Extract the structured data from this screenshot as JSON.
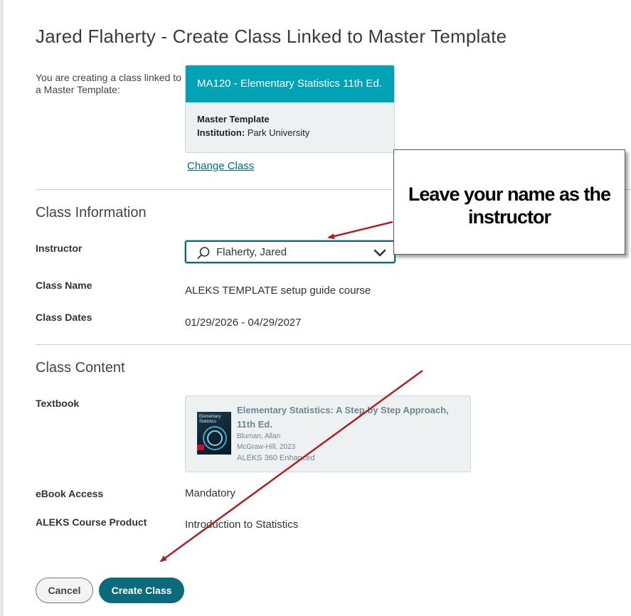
{
  "header": {
    "title": "Jared Flaherty - Create Class Linked to Master Template"
  },
  "intro": {
    "text": "You are creating a class linked to a Master Template:"
  },
  "template_card": {
    "class_name": "MA120 - Elementary Statistics 11th Ed.",
    "type_label": "Master Template",
    "institution_label": "Institution:",
    "institution_value": "Park University"
  },
  "change_class_link": "Change Class",
  "class_information": {
    "heading": "Class Information",
    "instructor_label": "Instructor",
    "instructor_value": "Flaherty, Jared",
    "class_name_label": "Class Name",
    "class_name_value": "ALEKS TEMPLATE setup guide course",
    "class_dates_label": "Class Dates",
    "class_dates_value": "01/29/2026 - 04/29/2027"
  },
  "class_content": {
    "heading": "Class Content",
    "textbook_label": "Textbook",
    "textbook": {
      "title": "Elementary Statistics: A Step by Step Approach, 11th Ed.",
      "author": "Bluman, Allan",
      "publisher": "McGraw-Hill, 2023",
      "product": "ALEKS 360 Enhanced",
      "cover_text": "Elementary Statistics"
    },
    "ebook_label": "eBook Access",
    "ebook_value": "Mandatory",
    "product_label": "ALEKS Course Product",
    "product_value": "Introduction to Statistics"
  },
  "buttons": {
    "cancel": "Cancel",
    "create": "Create Class"
  },
  "annotation": {
    "callout_text": "Leave your name as the instructor",
    "arrow_color": "#b01e23"
  },
  "colors": {
    "accent": "#00a3b5",
    "primary_button": "#0b6b7d",
    "link": "#006b80"
  },
  "icons": {
    "search": "search-icon",
    "dropdown": "chevron-down-icon"
  }
}
